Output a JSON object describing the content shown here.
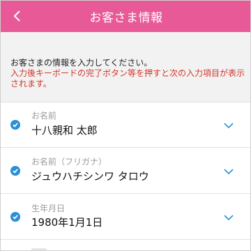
{
  "header": {
    "title": "お客さま情報",
    "accent_color": "#e85a97"
  },
  "notice": {
    "main": "お客さまの情報を入力してください。",
    "warning": "入力後キーボードの完了ボタン等を押すと次の入力項目が表示されます。",
    "warning_color": "#d0372b"
  },
  "fields": [
    {
      "label": "お名前",
      "value": "十八親和 太郎",
      "icon": "check-circle-icon"
    },
    {
      "label": "お名前（フリガナ）",
      "value": "ジュウハチシンワ タロウ",
      "icon": "check-circle-icon"
    },
    {
      "label": "生年月日",
      "value": "1980年1月1日",
      "icon": "check-circle-icon"
    }
  ],
  "check_color": "#2a8fd6"
}
